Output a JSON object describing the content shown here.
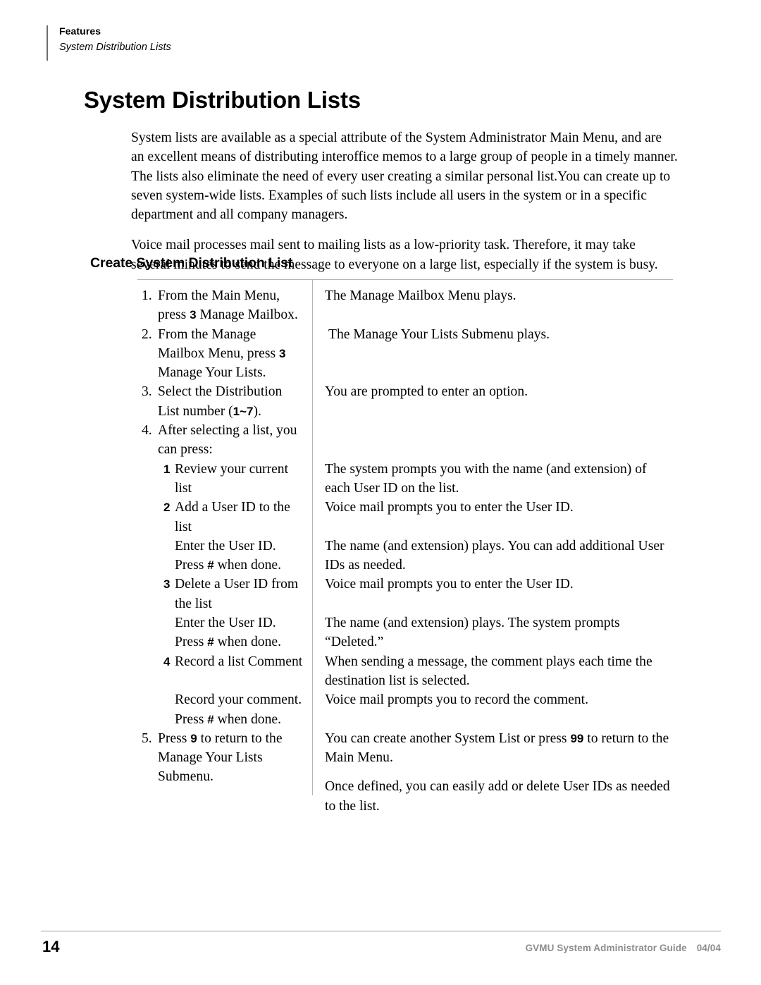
{
  "header": {
    "section": "Features",
    "subsection": "System Distribution Lists"
  },
  "page_title": "System Distribution Lists",
  "intro_paragraphs": [
    "System lists are available as a special attribute of the System Administrator Main Menu, and are an excellent means of distributing interoffice memos to a large group of people in a timely manner. The lists also eliminate the need of every user creating a similar personal list.You can create up to seven system-wide lists. Examples of such lists include all users in the system or in a specific department and all company managers.",
    "Voice mail processes mail sent to mailing lists as a low-priority task. Therefore, it may take several minutes to send the message to everyone on a large list, especially if the system is busy."
  ],
  "section_heading": "Create System Distribution List",
  "procedure": {
    "rows": [
      {
        "num": "1.",
        "left_pre": "From the Main Menu, press ",
        "key": "3",
        "left_post": " Manage Mailbox.",
        "right": "The Manage Mailbox Menu plays."
      },
      {
        "num": "2.",
        "left_pre": "From the Manage Mailbox Menu, press ",
        "key": "3",
        "left_post": " Manage Your Lists.",
        "right": " The Manage Your Lists Submenu plays."
      },
      {
        "num": "3.",
        "left_pre": "Select the Distribution List number (",
        "key": "1~7",
        "left_post": ").",
        "right": "You are prompted to enter an option."
      },
      {
        "num": "4.",
        "left_pre": "After selecting a list, you can press:",
        "key": "",
        "left_post": "",
        "right": ""
      },
      {
        "num": "1",
        "level": "sub",
        "left_pre": "Review your current list",
        "key": "",
        "left_post": "",
        "right": "The system prompts you with the name (and extension) of each User ID on the list."
      },
      {
        "num": "2",
        "level": "sub",
        "left_pre": "Add a User ID to the list",
        "key": "",
        "left_post": "",
        "right": "Voice mail prompts you to enter the User ID."
      },
      {
        "num": "",
        "level": "cont",
        "left_pre": "Enter the User ID. Press ",
        "key": "#",
        "left_post": " when done.",
        "right": "The name (and extension) plays. You can add additional User IDs as needed."
      },
      {
        "num": "3",
        "level": "sub",
        "left_pre": "Delete a User ID from the list",
        "key": "",
        "left_post": "",
        "right": "Voice mail prompts you to enter the User ID."
      },
      {
        "num": "",
        "level": "cont",
        "left_pre": "Enter the User ID. Press ",
        "key": "#",
        "left_post": " when done.",
        "right": "The name (and extension) plays. The system prompts “Deleted.”"
      },
      {
        "num": "4",
        "level": "sub",
        "left_pre": "Record a list Comment",
        "key": "",
        "left_post": "",
        "right": "When sending a message, the comment plays each time the destination list is selected."
      },
      {
        "num": "",
        "level": "cont",
        "left_pre": "Record your comment. Press ",
        "key": "#",
        "left_post": " when done.",
        "right": "Voice mail prompts you to record the comment."
      },
      {
        "num": "5.",
        "left_pre": "Press ",
        "key": "9",
        "left_post": " to return to the Manage Your Lists Submenu.",
        "right_pre": "You can create another System List or press ",
        "right_key": "99",
        "right_post": " to return to the Main Menu.",
        "right_extra": "Once defined, you can easily add or delete User IDs as needed to the list."
      }
    ]
  },
  "footer": {
    "page_number": "14",
    "guide": "GVMU System Administrator Guide",
    "date": "04/04"
  },
  "colors": {
    "rule": "#b4b4b4",
    "footer_rule": "#9a9a9a",
    "footer_text": "#8d8d8d",
    "header_rule": "#6e6e6e"
  }
}
